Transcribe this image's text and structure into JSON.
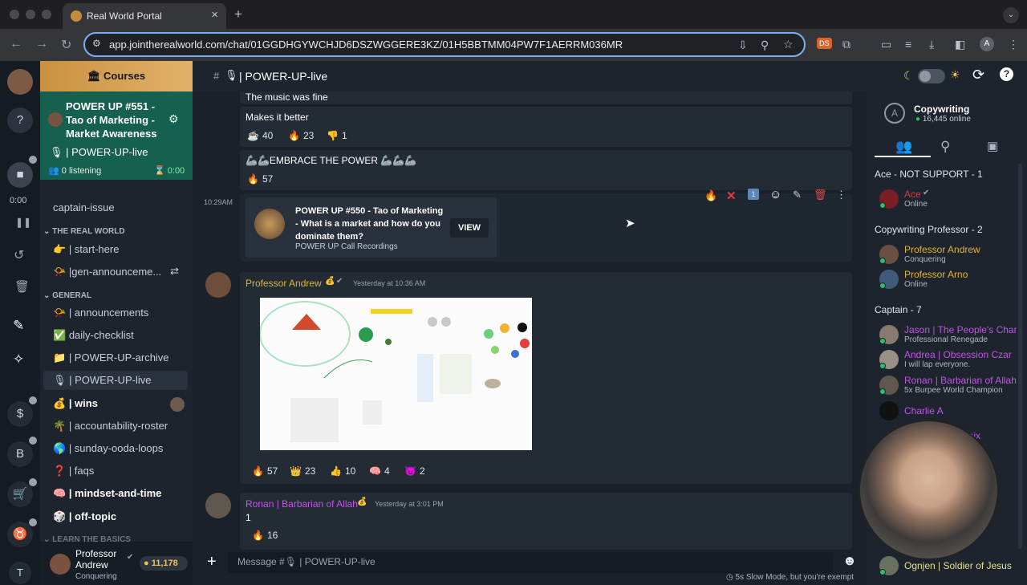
{
  "browser": {
    "tab_title": "Real World Portal",
    "url": "app.jointherealworld.com/chat/01GGDHGYWCHJD6DSZWGGERE3KZ/01H5BBTMM04PW7F1AERRM036MR"
  },
  "rail": {
    "timer": "0:00",
    "user_initial": "T"
  },
  "sidebar": {
    "courses_label": "Courses",
    "voice": {
      "title": "POWER UP #551 - Tao of Marketing - Market Awareness",
      "channel": "| POWER-UP-live",
      "listening": "0 listening",
      "timer": "0:00"
    },
    "captain_issue": "captain-issue",
    "cat_real_world": "THE REAL WORLD",
    "start_here": "| start-here",
    "gen_announcements": "|gen-announceme...",
    "cat_general": "GENERAL",
    "channels": [
      {
        "label": "| announcements",
        "bold": false
      },
      {
        "label": "daily-checklist",
        "bold": false
      },
      {
        "label": "| POWER-UP-archive",
        "bold": false
      },
      {
        "label": "| POWER-UP-live",
        "bold": false
      },
      {
        "label": "| wins",
        "bold": true
      },
      {
        "label": "| accountability-roster",
        "bold": false
      },
      {
        "label": "| sunday-ooda-loops",
        "bold": false
      },
      {
        "label": "| faqs",
        "bold": false
      },
      {
        "label": "| mindset-and-time",
        "bold": true
      },
      {
        "label": "| off-topic",
        "bold": true
      }
    ],
    "cat_learn": "LEARN THE BASICS",
    "profile": {
      "name": "Professor Andrew",
      "status": "Conquering",
      "coins": "11,178"
    }
  },
  "header": {
    "channel_name": "| POWER-UP-live"
  },
  "messages": {
    "m1_text": "The music was fine",
    "m2_text": "Makes it better",
    "m2_reactions": [
      {
        "emoji": "☕",
        "count": "40"
      },
      {
        "emoji": "🔥",
        "count": "23"
      },
      {
        "emoji": "👎",
        "count": "1"
      }
    ],
    "m3_text": "🦾🦾EMBRACE THE POWER 🦾🦾🦾",
    "m3_reaction": {
      "emoji": "🔥",
      "count": "57"
    },
    "m4_time": "10:29AM",
    "m4_card": {
      "title": "POWER UP #550 - Tao of Marketing - What is a market and how do you dominate them?",
      "subtitle": "POWER UP Call Recordings",
      "button": "VIEW"
    },
    "m5_user": "Professor Andrew",
    "m5_time": "Yesterday at 10:36 AM",
    "m5_reactions": [
      {
        "emoji": "🔥",
        "count": "57"
      },
      {
        "emoji": "👑",
        "count": "23"
      },
      {
        "emoji": "👍",
        "count": "10"
      },
      {
        "emoji": "🧠",
        "count": "4"
      },
      {
        "emoji": "😈",
        "count": "2"
      }
    ],
    "m6_user": "Ronan | Barbarian of Allah",
    "m6_time": "Yesterday at 3:01 PM",
    "m6_text": "1",
    "m6_reaction": {
      "emoji": "🔥",
      "count": "16"
    }
  },
  "composer": {
    "placeholder": "Message #🎙 | POWER-UP-live",
    "slow_mode": "5s Slow Mode, but you're exempt"
  },
  "members": {
    "campus_name": "Copywriting",
    "online": "16,445 online",
    "sections": {
      "ace": "Ace - NOT SUPPORT - 1",
      "profs": "Copywriting Professor - 2",
      "captain": "Captain - 7"
    },
    "list": {
      "ace": {
        "name": "Ace",
        "status": "Online"
      },
      "andrew": {
        "name": "Professor Andrew",
        "status": "Conquering"
      },
      "arno": {
        "name": "Professor Arno",
        "status": "Online"
      },
      "jason": {
        "name": "Jason | The People's Chan",
        "status": "Professional Renegade"
      },
      "andrea": {
        "name": "Andrea | Obsession Czar",
        "status": "I will lap everyone."
      },
      "ronan": {
        "name": "Ronan | Barbarian of Allah",
        "status": "5x Burpee World Champion"
      },
      "charlie": {
        "name": "Charlie A",
        "status": ""
      },
      "phoenix": {
        "name": "enix",
        "status": ""
      },
      "ognjen": {
        "name": "Ognjen | Soldier of Jesus",
        "status": ""
      }
    }
  },
  "colors": {
    "accent_gold": "#e2b26a",
    "professor_gold": "#e0b336",
    "captain_purple": "#c055e6",
    "online_green": "#2fbd6c",
    "ace_red": "#d93a48"
  }
}
